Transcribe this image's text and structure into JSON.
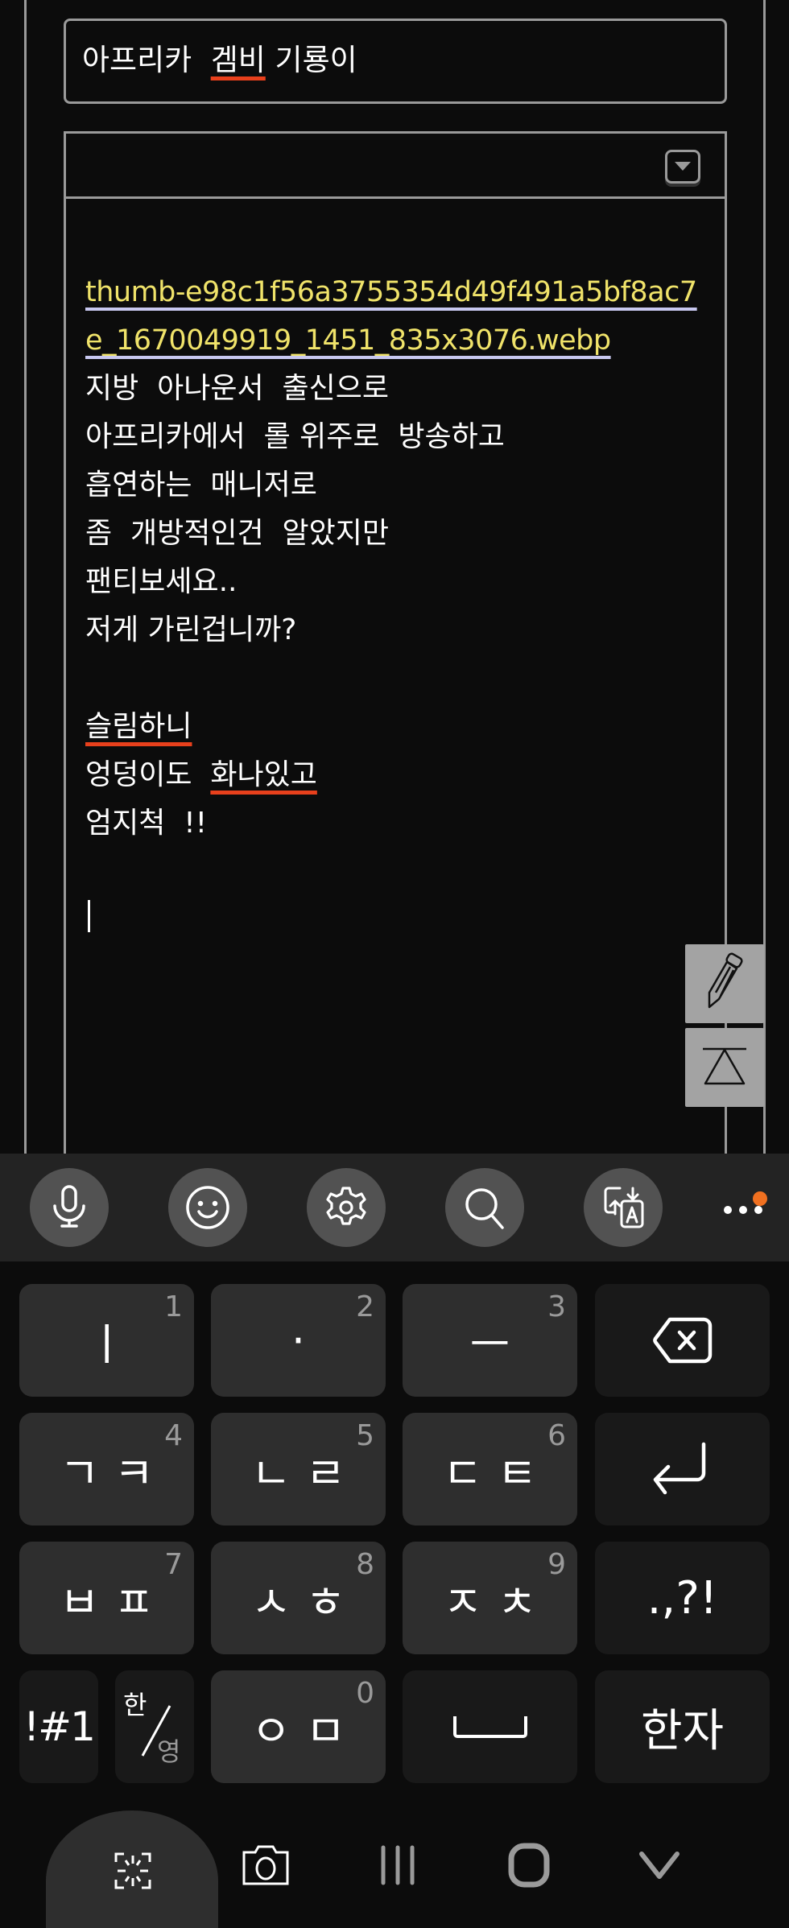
{
  "title_field": {
    "segments": [
      {
        "text": "아프리카  ",
        "misspelled": false
      },
      {
        "text": "겜비",
        "misspelled": true
      },
      {
        "text": " 기룡이",
        "misspelled": false
      }
    ]
  },
  "editor": {
    "dropdown_icon": "caret-down-icon",
    "link_lines": [
      "thumb-e98c1f56a3755354d49f491a5bf8ac7",
      "e_1670049919_1451_835x3076.webp"
    ],
    "lines": [
      [
        {
          "text": "지방  아나운서  출신으로"
        }
      ],
      [
        {
          "text": "아프리카에서  롤 위주로  방송하고"
        }
      ],
      [
        {
          "text": "흡연하는  매니저로"
        }
      ],
      [
        {
          "text": "좀  개방적인건  알았지만"
        }
      ],
      [
        {
          "text": "팬티보세요.."
        }
      ],
      [
        {
          "text": "저게 가린겁니까?"
        }
      ],
      [
        {
          "text": ""
        }
      ],
      [
        {
          "text": "슬림하니",
          "misspelled": true
        }
      ],
      [
        {
          "text": "엉덩이도  "
        },
        {
          "text": "화나있고",
          "misspelled": true
        }
      ],
      [
        {
          "text": "엄지척  !!"
        }
      ],
      [
        {
          "text": ""
        }
      ]
    ]
  },
  "floating_buttons": [
    {
      "name": "pencil-icon"
    },
    {
      "name": "scroll-top-icon"
    }
  ],
  "keyboard_toolbar": {
    "buttons": [
      "microphone-icon",
      "emoji-icon",
      "settings-icon",
      "search-icon",
      "translate-icon"
    ],
    "more": "more-icon",
    "notification_color": "#f07020"
  },
  "keyboard": {
    "rows": [
      [
        {
          "label": "ㅣ",
          "num": "1"
        },
        {
          "label": "·",
          "num": "2"
        },
        {
          "label": "ㅡ",
          "num": "3"
        },
        {
          "label": "",
          "icon": "backspace-icon"
        }
      ],
      [
        {
          "label": "ㄱㅋ",
          "num": "4"
        },
        {
          "label": "ㄴㄹ",
          "num": "5"
        },
        {
          "label": "ㄷㅌ",
          "num": "6"
        },
        {
          "label": "",
          "icon": "enter-icon"
        }
      ],
      [
        {
          "label": "ㅂㅍ",
          "num": "7"
        },
        {
          "label": "ㅅㅎ",
          "num": "8"
        },
        {
          "label": "ㅈㅊ",
          "num": "9"
        },
        {
          "label": ".,?!"
        }
      ],
      [
        {
          "label": "!#1"
        },
        {
          "label_top": "한",
          "label_bottom": "영"
        },
        {
          "label": "ㅇㅁ",
          "num": "0"
        },
        {
          "label": "",
          "icon": "space-icon"
        },
        {
          "label": "한자"
        }
      ]
    ]
  },
  "nav_bar": {
    "buttons": [
      "screen-capture-icon",
      "camera-icon",
      "recent-apps-icon",
      "home-icon",
      "hide-keyboard-icon"
    ]
  }
}
